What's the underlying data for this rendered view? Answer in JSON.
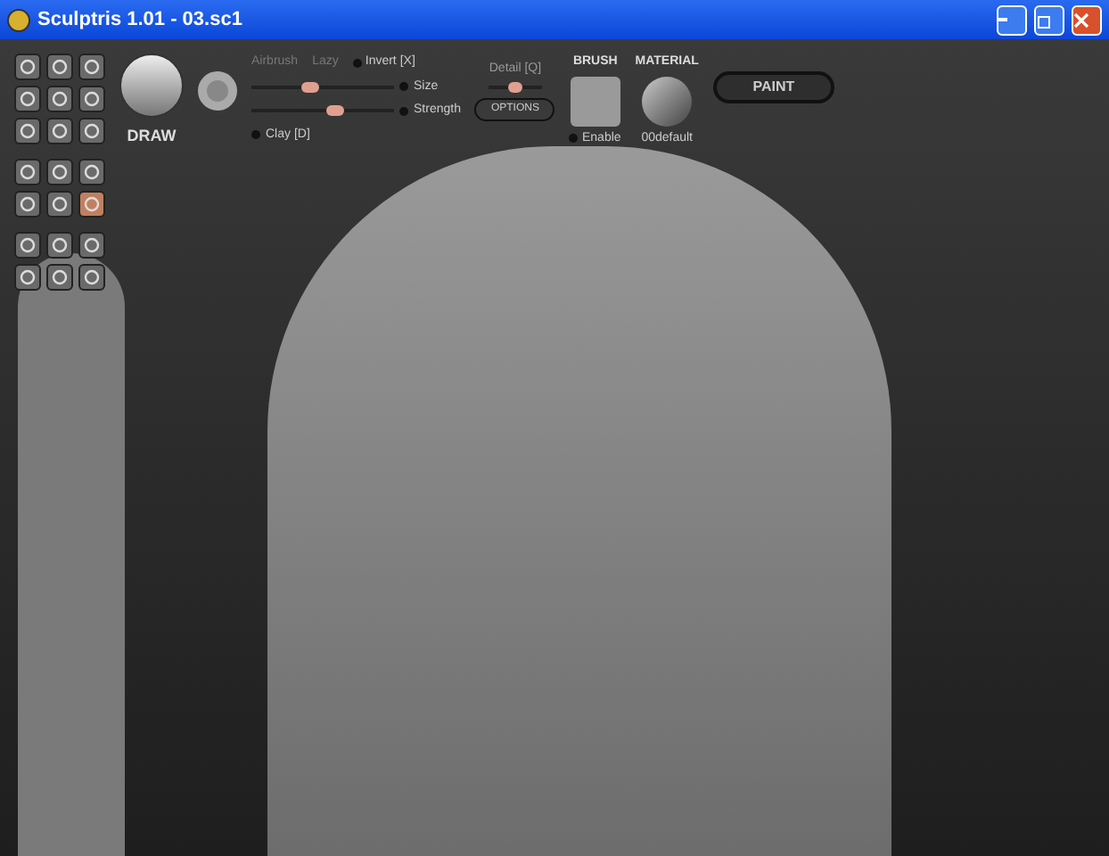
{
  "window": {
    "title": "Sculptris 1.01 - 03.sc1"
  },
  "tool_groups": [
    [
      {
        "selected": false
      },
      {
        "selected": false
      },
      {
        "selected": false
      },
      {
        "selected": false
      },
      {
        "selected": false
      },
      {
        "selected": false
      },
      {
        "selected": false
      },
      {
        "selected": false
      },
      {
        "selected": false
      }
    ],
    [
      {
        "selected": false
      },
      {
        "selected": false
      },
      {
        "selected": false
      },
      {
        "selected": false
      },
      {
        "selected": false
      },
      {
        "selected": true
      }
    ],
    [
      {
        "selected": false
      },
      {
        "selected": false
      },
      {
        "selected": false
      },
      {
        "selected": false
      },
      {
        "selected": false
      },
      {
        "selected": false
      }
    ]
  ],
  "brush_tool": {
    "label": "DRAW"
  },
  "toggles": [
    {
      "label": "Airbrush",
      "disabled": true
    },
    {
      "label": "Lazy",
      "disabled": true
    },
    {
      "label": "Invert [X]",
      "on": false,
      "disabled": false
    }
  ],
  "sliders": [
    {
      "label": "Size",
      "level": 0.4
    },
    {
      "label": "Strength",
      "level": 0.6
    }
  ],
  "clay": {
    "label": "Clay [D]",
    "on": false
  },
  "detail": {
    "label": "Detail [Q]",
    "level": 0.5
  },
  "options_button": "OPTIONS",
  "brush": {
    "title": "BRUSH",
    "enable_label": "Enable",
    "enabled": false
  },
  "material": {
    "title": "MATERIAL",
    "name": "00default"
  },
  "paint_button": "PAINT"
}
